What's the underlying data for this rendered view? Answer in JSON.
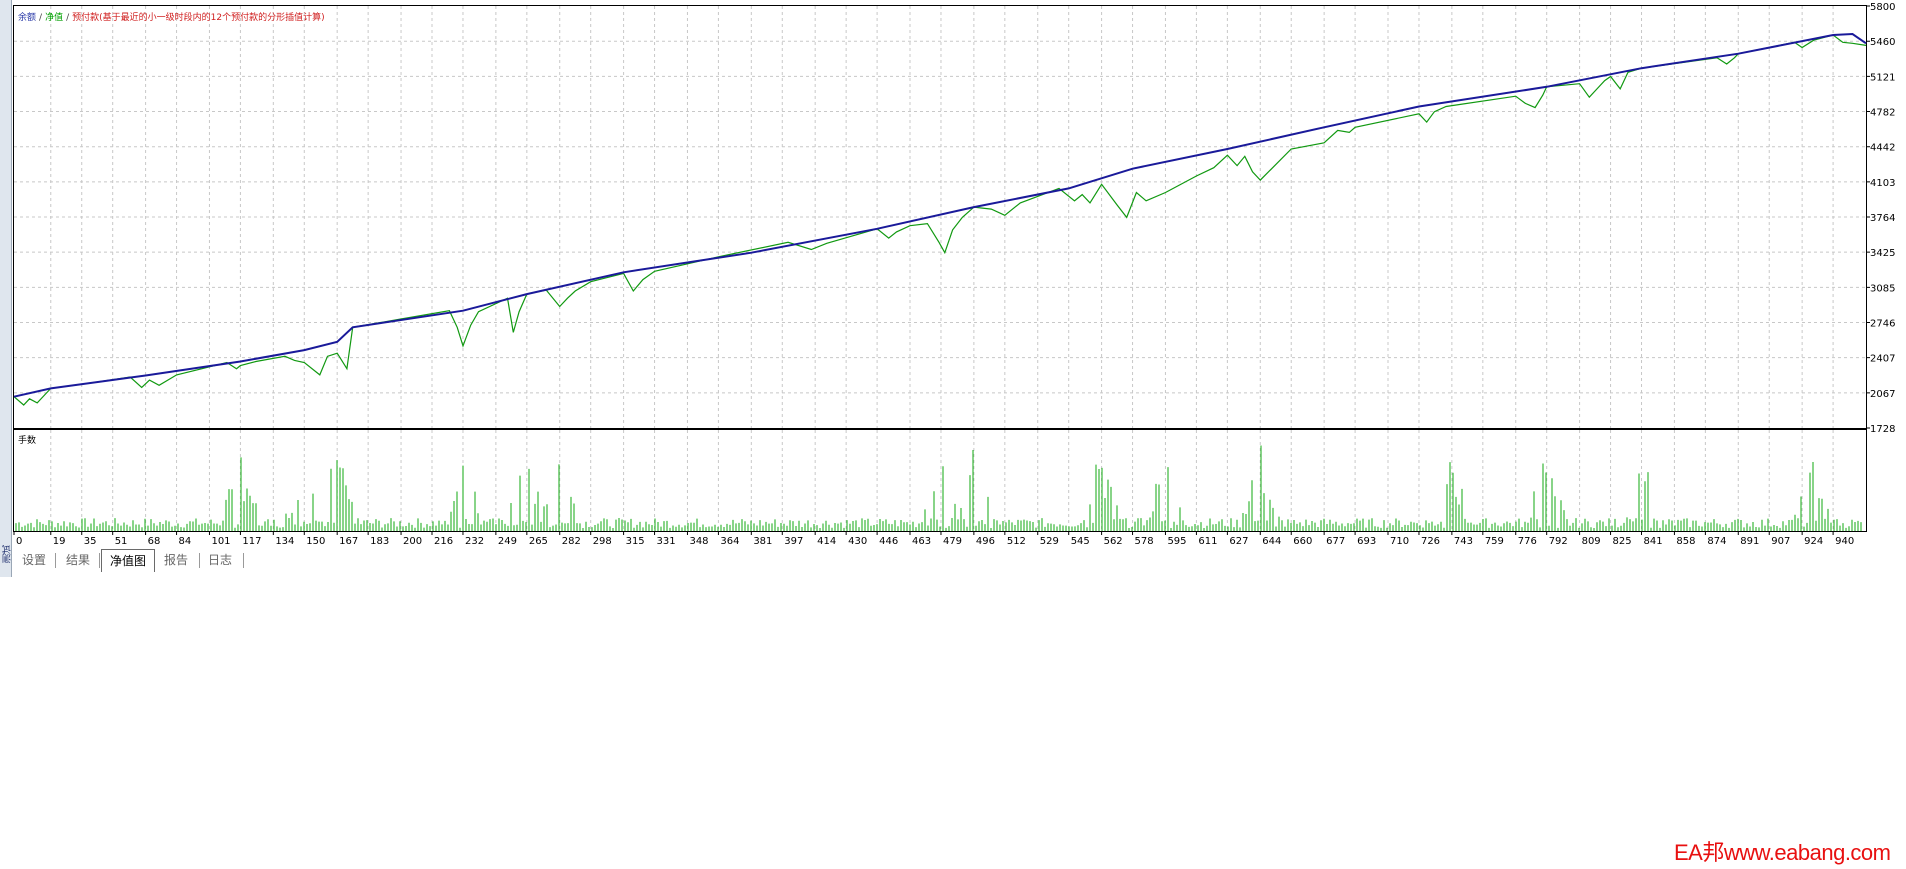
{
  "legend": {
    "balance": "余额",
    "equity": "净值",
    "margin": "预付款(基于最近的小一级时段内的12个预付款的分形插值计算)",
    "sep": "/"
  },
  "volume_title": "手数",
  "left_label": "测试",
  "tabs": [
    {
      "label": "设置",
      "active": false
    },
    {
      "label": "结果",
      "active": false
    },
    {
      "label": "净值图",
      "active": true
    },
    {
      "label": "报告",
      "active": false
    },
    {
      "label": "日志",
      "active": false
    }
  ],
  "watermark": "EA邦www.eabang.com",
  "colors": {
    "balance": "#1a1a9a",
    "equity": "#119911",
    "volume": "#11aa11",
    "grid": "#c8c8c8"
  },
  "chart_data": {
    "type": "line",
    "title": "",
    "y_ticks": [
      5800,
      5460,
      5121,
      4782,
      4442,
      4103,
      3764,
      3425,
      3085,
      2746,
      2407,
      2067,
      1728
    ],
    "ylim": [
      1728,
      5800
    ],
    "x_ticks": [
      0,
      19,
      35,
      51,
      68,
      84,
      101,
      117,
      134,
      150,
      167,
      183,
      200,
      216,
      232,
      249,
      265,
      282,
      298,
      315,
      331,
      348,
      364,
      381,
      397,
      414,
      430,
      446,
      463,
      479,
      496,
      512,
      529,
      545,
      562,
      578,
      595,
      611,
      627,
      644,
      660,
      677,
      693,
      710,
      726,
      743,
      759,
      776,
      792,
      809,
      825,
      841,
      858,
      874,
      891,
      907,
      924,
      940
    ],
    "xlim": [
      0,
      957
    ],
    "grid": true,
    "legend_position": "top-left",
    "series": [
      {
        "name": "余额",
        "x": [
          0,
          19,
          68,
          117,
          150,
          167,
          175,
          232,
          265,
          315,
          381,
          446,
          496,
          545,
          578,
          627,
          677,
          726,
          792,
          841,
          891,
          940,
          950,
          957
        ],
        "values": [
          2030,
          2110,
          2235,
          2370,
          2480,
          2560,
          2700,
          2860,
          3020,
          3230,
          3420,
          3650,
          3860,
          4040,
          4230,
          4420,
          4630,
          4830,
          5020,
          5200,
          5340,
          5520,
          5530,
          5440
        ]
      },
      {
        "name": "净值",
        "x": [
          0,
          5,
          8,
          12,
          19,
          35,
          60,
          66,
          70,
          75,
          84,
          110,
          115,
          117,
          125,
          140,
          145,
          150,
          158,
          162,
          167,
          172,
          175,
          200,
          225,
          229,
          232,
          236,
          240,
          255,
          258,
          261,
          265,
          275,
          282,
          286,
          290,
          298,
          315,
          320,
          325,
          331,
          364,
          400,
          412,
          420,
          446,
          452,
          456,
          463,
          472,
          478,
          481,
          485,
          490,
          496,
          505,
          512,
          520,
          540,
          548,
          552,
          556,
          562,
          570,
          575,
          580,
          585,
          595,
          611,
          620,
          627,
          632,
          636,
          640,
          644,
          660,
          677,
          684,
          690,
          693,
          726,
          730,
          734,
          740,
          776,
          781,
          786,
          790,
          792,
          809,
          814,
          818,
          822,
          825,
          830,
          834,
          841,
          880,
          885,
          889,
          891,
          920,
          924,
          930,
          940,
          945,
          950,
          957
        ],
        "values": [
          2030,
          1950,
          2010,
          1970,
          2110,
          2150,
          2220,
          2120,
          2190,
          2140,
          2240,
          2360,
          2300,
          2330,
          2370,
          2420,
          2380,
          2360,
          2240,
          2420,
          2450,
          2300,
          2700,
          2780,
          2860,
          2700,
          2520,
          2720,
          2850,
          2980,
          2650,
          2850,
          3020,
          3060,
          2900,
          2980,
          3050,
          3140,
          3220,
          3050,
          3160,
          3240,
          3380,
          3520,
          3450,
          3510,
          3650,
          3560,
          3620,
          3680,
          3700,
          3520,
          3420,
          3640,
          3760,
          3860,
          3840,
          3780,
          3900,
          4040,
          3920,
          3980,
          3900,
          4080,
          3880,
          3760,
          4000,
          3920,
          4000,
          4160,
          4240,
          4360,
          4260,
          4350,
          4200,
          4120,
          4420,
          4480,
          4600,
          4580,
          4630,
          4760,
          4680,
          4780,
          4830,
          4930,
          4860,
          4820,
          4940,
          5020,
          5050,
          4920,
          5000,
          5080,
          5120,
          5000,
          5160,
          5200,
          5300,
          5240,
          5300,
          5340,
          5450,
          5400,
          5470,
          5520,
          5450,
          5440,
          5420
        ]
      }
    ]
  }
}
